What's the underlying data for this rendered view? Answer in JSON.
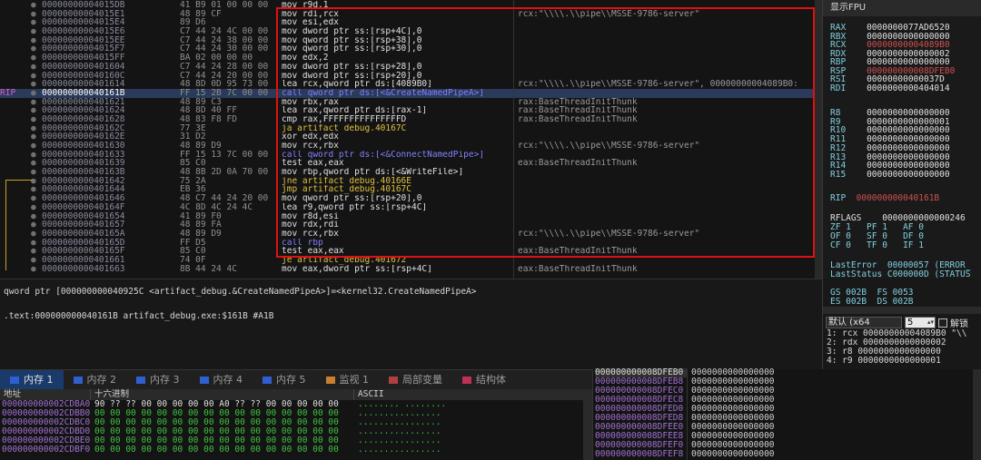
{
  "rip_label": "RIP",
  "disasm": [
    {
      "addr": "00000000004015DB",
      "hex": "41 B9 01 00 00 00",
      "ins": "mov r9d,1",
      "cmt": ""
    },
    {
      "addr": "00000000004015E1",
      "hex": "48 89 CF",
      "ins": "mov rdi,rcx",
      "cmt": "rcx:\"\\\\\\\\.\\\\pipe\\\\MSSE-9786-server\""
    },
    {
      "addr": "00000000004015E4",
      "hex": "89 D6",
      "ins": "mov esi,edx",
      "cmt": ""
    },
    {
      "addr": "00000000004015E6",
      "hex": "C7 44 24 4C 00 00",
      "ins": "mov dword ptr ss:[rsp+4C],0",
      "cmt": ""
    },
    {
      "addr": "00000000004015EE",
      "hex": "C7 44 24 38 00 00",
      "ins": "mov qword ptr ss:[rsp+38],0",
      "cmt": ""
    },
    {
      "addr": "00000000004015F7",
      "hex": "C7 44 24 30 00 00",
      "ins": "mov qword ptr ss:[rsp+30],0",
      "cmt": ""
    },
    {
      "addr": "00000000004015FF",
      "hex": "BA 02 00 00 00",
      "ins": "mov edx,2",
      "cmt": ""
    },
    {
      "addr": "0000000000401604",
      "hex": "C7 44 24 28 00 00",
      "ins": "mov dword ptr ss:[rsp+28],0",
      "cmt": ""
    },
    {
      "addr": "000000000040160C",
      "hex": "C7 44 24 20 00 00",
      "ins": "mov dword ptr ss:[rsp+20],0",
      "cmt": ""
    },
    {
      "addr": "0000000000401614",
      "hex": "48 8D 0D 95 73 00",
      "ins": "lea rcx,qword ptr ds:[4089B0]",
      "cmt": "rcx:\"\\\\\\\\.\\\\pipe\\\\MSSE-9786-server\", 00000000004089B0:"
    },
    {
      "addr": "000000000040161B",
      "hex": "FF 15 2B 7C 00 00",
      "ins": "call qword ptr ds:[<&CreateNamedPipeA>]",
      "cmt": ""
    },
    {
      "addr": "0000000000401621",
      "hex": "48 89 C3",
      "ins": "mov rbx,rax",
      "cmt": "rax:BaseThreadInitThunk"
    },
    {
      "addr": "0000000000401624",
      "hex": "48 8D 40 FF",
      "ins": "lea rax,qword ptr ds:[rax-1]",
      "cmt": "rax:BaseThreadInitThunk"
    },
    {
      "addr": "0000000000401628",
      "hex": "48 83 F8 FD",
      "ins": "cmp rax,FFFFFFFFFFFFFFFD",
      "cmt": "rax:BaseThreadInitThunk"
    },
    {
      "addr": "000000000040162C",
      "hex": "77 3E",
      "ins": "ja artifact_debug.40167C",
      "cmt": ""
    },
    {
      "addr": "000000000040162E",
      "hex": "31 D2",
      "ins": "xor edx,edx",
      "cmt": ""
    },
    {
      "addr": "0000000000401630",
      "hex": "48 89 D9",
      "ins": "mov rcx,rbx",
      "cmt": "rcx:\"\\\\\\\\.\\\\pipe\\\\MSSE-9786-server\""
    },
    {
      "addr": "0000000000401633",
      "hex": "FF 15 13 7C 00 00",
      "ins": "call qword ptr ds:[<&ConnectNamedPipe>]",
      "cmt": ""
    },
    {
      "addr": "0000000000401639",
      "hex": "85 C0",
      "ins": "test eax,eax",
      "cmt": "eax:BaseThreadInitThunk"
    },
    {
      "addr": "000000000040163B",
      "hex": "48 8B 2D 0A 70 00",
      "ins": "mov rbp,qword ptr ds:[<&WriteFile>]",
      "cmt": ""
    },
    {
      "addr": "0000000000401642",
      "hex": "75 2A",
      "ins": "jne artifact_debug.40166E",
      "cmt": ""
    },
    {
      "addr": "0000000000401644",
      "hex": "EB 36",
      "ins": "jmp artifact_debug.40167C",
      "cmt": ""
    },
    {
      "addr": "0000000000401646",
      "hex": "48 C7 44 24 20 00",
      "ins": "mov qword ptr ss:[rsp+20],0",
      "cmt": ""
    },
    {
      "addr": "000000000040164F",
      "hex": "4C 8D 4C 24 4C",
      "ins": "lea r9,qword ptr ss:[rsp+4C]",
      "cmt": ""
    },
    {
      "addr": "0000000000401654",
      "hex": "41 89 F0",
      "ins": "mov r8d,esi",
      "cmt": ""
    },
    {
      "addr": "0000000000401657",
      "hex": "48 89 FA",
      "ins": "mov rdx,rdi",
      "cmt": ""
    },
    {
      "addr": "000000000040165A",
      "hex": "48 89 D9",
      "ins": "mov rcx,rbx",
      "cmt": "rcx:\"\\\\\\\\.\\\\pipe\\\\MSSE-9786-server\""
    },
    {
      "addr": "000000000040165D",
      "hex": "FF D5",
      "ins": "call rbp",
      "cmt": ""
    },
    {
      "addr": "000000000040165F",
      "hex": "85 C0",
      "ins": "test eax,eax",
      "cmt": "eax:BaseThreadInitThunk"
    },
    {
      "addr": "0000000000401661",
      "hex": "74 0F",
      "ins": "je artifact_debug.401672",
      "cmt": ""
    },
    {
      "addr": "0000000000401663",
      "hex": "8B 44 24 4C",
      "ins": "mov eax,dword ptr ss:[rsp+4C]",
      "cmt": "eax:BaseThreadInitThunk"
    }
  ],
  "fpu": {
    "title": "显示FPU",
    "regs": [
      {
        "n": "RAX",
        "v": "0000000077AD6520"
      },
      {
        "n": "RBX",
        "v": "0000000000000000"
      },
      {
        "n": "RCX",
        "v": "00000000004089B0"
      },
      {
        "n": "RDX",
        "v": "0000000000000002"
      },
      {
        "n": "RBP",
        "v": "0000000000000000"
      },
      {
        "n": "RSP",
        "v": "000000000008DFEB0"
      },
      {
        "n": "RSI",
        "v": "00000000000037D"
      },
      {
        "n": "RDI",
        "v": "0000000000404014"
      },
      {
        "n": "R8",
        "v": "0000000000000000"
      },
      {
        "n": "R9",
        "v": "0000000000000001"
      },
      {
        "n": "R10",
        "v": "0000000000000000"
      },
      {
        "n": "R11",
        "v": "0000000000000000"
      },
      {
        "n": "R12",
        "v": "0000000000000000"
      },
      {
        "n": "R13",
        "v": "0000000000000000"
      },
      {
        "n": "R14",
        "v": "0000000000000000"
      },
      {
        "n": "R15",
        "v": "0000000000000000"
      }
    ],
    "rip": {
      "n": "RIP",
      "v": "000000000040161B"
    },
    "rflags": "RFLAGS    0000000000000246",
    "flags1": "ZF 1   PF 1   AF 0",
    "flags2": "OF 0   SF 0   DF 0",
    "flags3": "CF 0   TF 0   IF 1",
    "lasterr": "LastError  00000057 (ERROR_",
    "laststat": "LastStatus C000000D (STATUS",
    "seg1": "GS 002B  FS 0053",
    "seg2": "ES 002B  DS 002B"
  },
  "info": {
    "line1": "qword ptr [000000000040925C <artifact_debug.&CreateNamedPipeA>]=<kernel32.CreateNamedPipeA>",
    "line2": ".text:000000000040161B artifact_debug.exe:$161B #A1B"
  },
  "callconv": {
    "label": "默认 (x64",
    "count": "5",
    "lock": "解锁",
    "args": [
      "1: rcx 00000000004089B0 \"\\\\",
      "2: rdx 0000000000000002",
      "3: r8 0000000000000000",
      "4: r9 0000000000000001"
    ]
  },
  "tabs": [
    {
      "label": "内存 1",
      "active": true
    },
    {
      "label": "内存 2",
      "active": false
    },
    {
      "label": "内存 3",
      "active": false
    },
    {
      "label": "内存 4",
      "active": false
    },
    {
      "label": "内存 5",
      "active": false
    },
    {
      "label": "监视 1",
      "active": false
    },
    {
      "label": "局部变量",
      "active": false
    },
    {
      "label": "结构体",
      "active": false
    }
  ],
  "dump": {
    "hdr_addr": "地址",
    "hdr_hex": "十六进制",
    "hdr_ascii": "ASCII",
    "rows": [
      {
        "a": "000000000002CDBA0",
        "h": "90 ?? ?? 00 00 00 00 00 A0 ?? ?? 00 00 00 00 00",
        "s": "........ ........"
      },
      {
        "a": "000000000002CDBB0",
        "h": "00 00 00 00 00 00 00 00 00 00 00 00 00 00 00 00",
        "s": "................"
      },
      {
        "a": "000000000002CDBC0",
        "h": "00 00 00 00 00 00 00 00 00 00 00 00 00 00 00 00",
        "s": "................"
      },
      {
        "a": "000000000002CDBD0",
        "h": "00 00 00 00 00 00 00 00 00 00 00 00 00 00 00 00",
        "s": "................"
      },
      {
        "a": "000000000002CDBE0",
        "h": "00 00 00 00 00 00 00 00 00 00 00 00 00 00 00 00",
        "s": "................"
      },
      {
        "a": "000000000002CDBF0",
        "h": "00 00 00 00 00 00 00 00 00 00 00 00 00 00 00 00",
        "s": "................"
      }
    ]
  },
  "stack": [
    {
      "a": "000000000008DFEB0",
      "v": "0000000000000000"
    },
    {
      "a": "000000000008DFEB8",
      "v": "0000000000000000"
    },
    {
      "a": "000000000008DFEC0",
      "v": "0000000000000000"
    },
    {
      "a": "000000000008DFEC8",
      "v": "0000000000000000"
    },
    {
      "a": "000000000008DFED0",
      "v": "0000000000000000"
    },
    {
      "a": "000000000008DFED8",
      "v": "0000000000000000"
    },
    {
      "a": "000000000008DFEE0",
      "v": "0000000000000000"
    },
    {
      "a": "000000000008DFEE8",
      "v": "0000000000000000"
    },
    {
      "a": "000000000008DFEF0",
      "v": "0000000000000000"
    },
    {
      "a": "000000000008DFEF8",
      "v": "0000000000000000"
    }
  ],
  "colors": {
    "highlight_box": "#e01010",
    "rip_row": "#2a3a5a",
    "tab_active": "#1a3a6a"
  }
}
